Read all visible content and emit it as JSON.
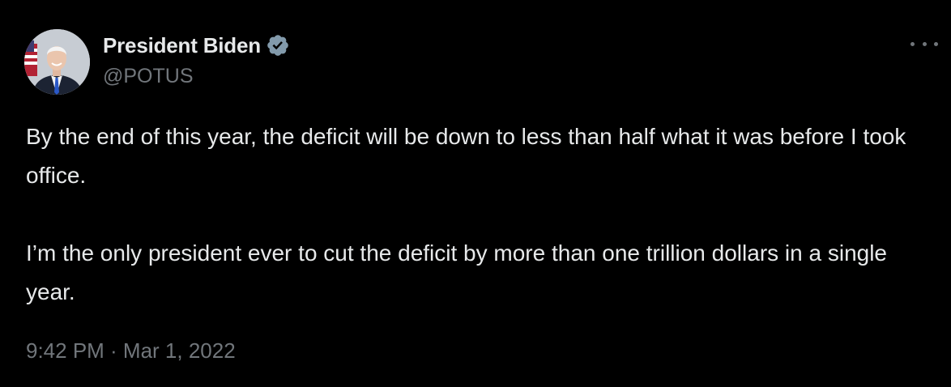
{
  "author": {
    "display_name": "President Biden",
    "handle": "@POTUS",
    "verified": true,
    "avatar_icon": "user-portrait-avatar"
  },
  "tweet": {
    "paragraphs": [
      "By the end of this year, the deficit will be down to less than half what it was before I took office.",
      "I’m the only president ever to cut the deficit by more than one trillion dollars in a single year."
    ],
    "timestamp": "9:42 PM · Mar 1, 2022"
  },
  "icons": {
    "verified": "verified-badge-icon",
    "more": "more-options-icon"
  },
  "colors": {
    "background": "#000000",
    "primary_text": "#e7e9ea",
    "secondary_text": "#71767b",
    "verified_badge": "#829aab"
  }
}
